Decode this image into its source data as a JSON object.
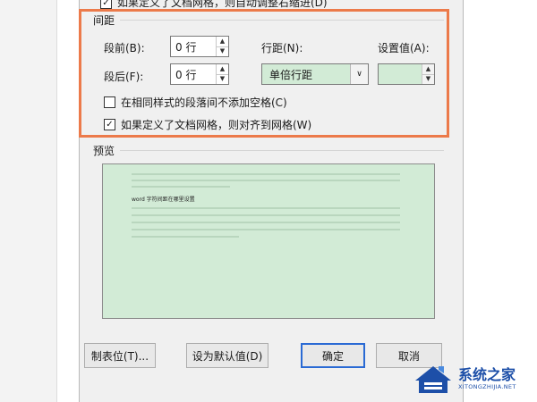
{
  "top_partial": {
    "label": "如果定义了文档网格，则自动调整右缩进(D)"
  },
  "spacing": {
    "title": "间距",
    "before_label": "段前(B):",
    "before_value": "0 行",
    "after_label": "段后(F):",
    "after_value": "0 行",
    "line_spacing_label": "行距(N):",
    "line_spacing_value": "单倍行距",
    "set_value_label": "设置值(A):",
    "set_value_value": "",
    "no_space_same_style": {
      "label": "在相同样式的段落间不添加空格(C)",
      "checked": false
    },
    "snap_to_grid": {
      "label": "如果定义了文档网格，则对齐到网格(W)",
      "checked": true
    }
  },
  "preview": {
    "title": "预览",
    "sample_text": "word 字符间距在哪里设置"
  },
  "buttons": {
    "tabs": "制表位(T)...",
    "set_default": "设为默认值(D)",
    "ok": "确定",
    "cancel": "取消"
  },
  "watermark": {
    "title": "系统之家",
    "url": "XITONGZHIJIA.NET"
  },
  "colors": {
    "highlight": "#ec7a4a",
    "preview_bg": "#d2ebd6",
    "primary_button_border": "#2a6ad4"
  }
}
